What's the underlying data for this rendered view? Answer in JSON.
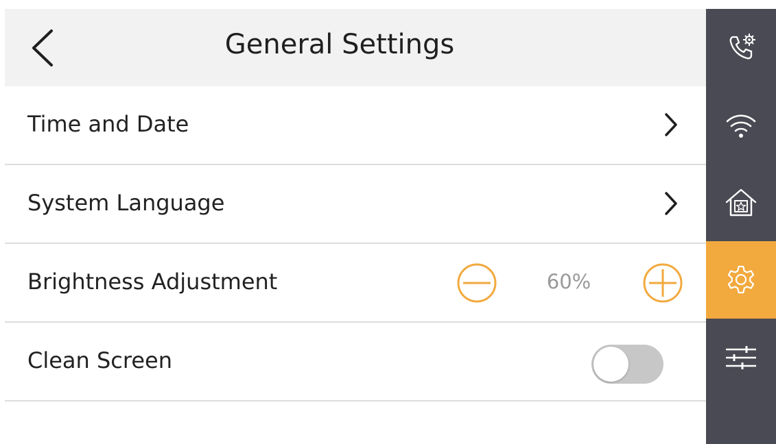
{
  "header": {
    "title": "General Settings"
  },
  "rows": [
    {
      "label": "Time and Date"
    },
    {
      "label": "System Language"
    },
    {
      "label": "Brightness Adjustment",
      "value": "60%"
    },
    {
      "label": "Clean Screen",
      "toggle_on": false
    }
  ],
  "brightness": {
    "value_fraction": 0.6
  },
  "sidebar": {
    "items": [
      {
        "icon": "call-settings-icon",
        "active": false
      },
      {
        "icon": "wifi-icon",
        "active": false
      },
      {
        "icon": "home-star-icon",
        "active": false
      },
      {
        "icon": "gear-icon",
        "active": true
      },
      {
        "icon": "sliders-icon",
        "active": false
      }
    ]
  },
  "colors": {
    "accent": "#f2a93e",
    "sidebar_bg": "#4a4a54",
    "header_bg": "#f2f2f2",
    "divider": "#dcdcdc",
    "toggle_off": "#c7c7c7"
  }
}
